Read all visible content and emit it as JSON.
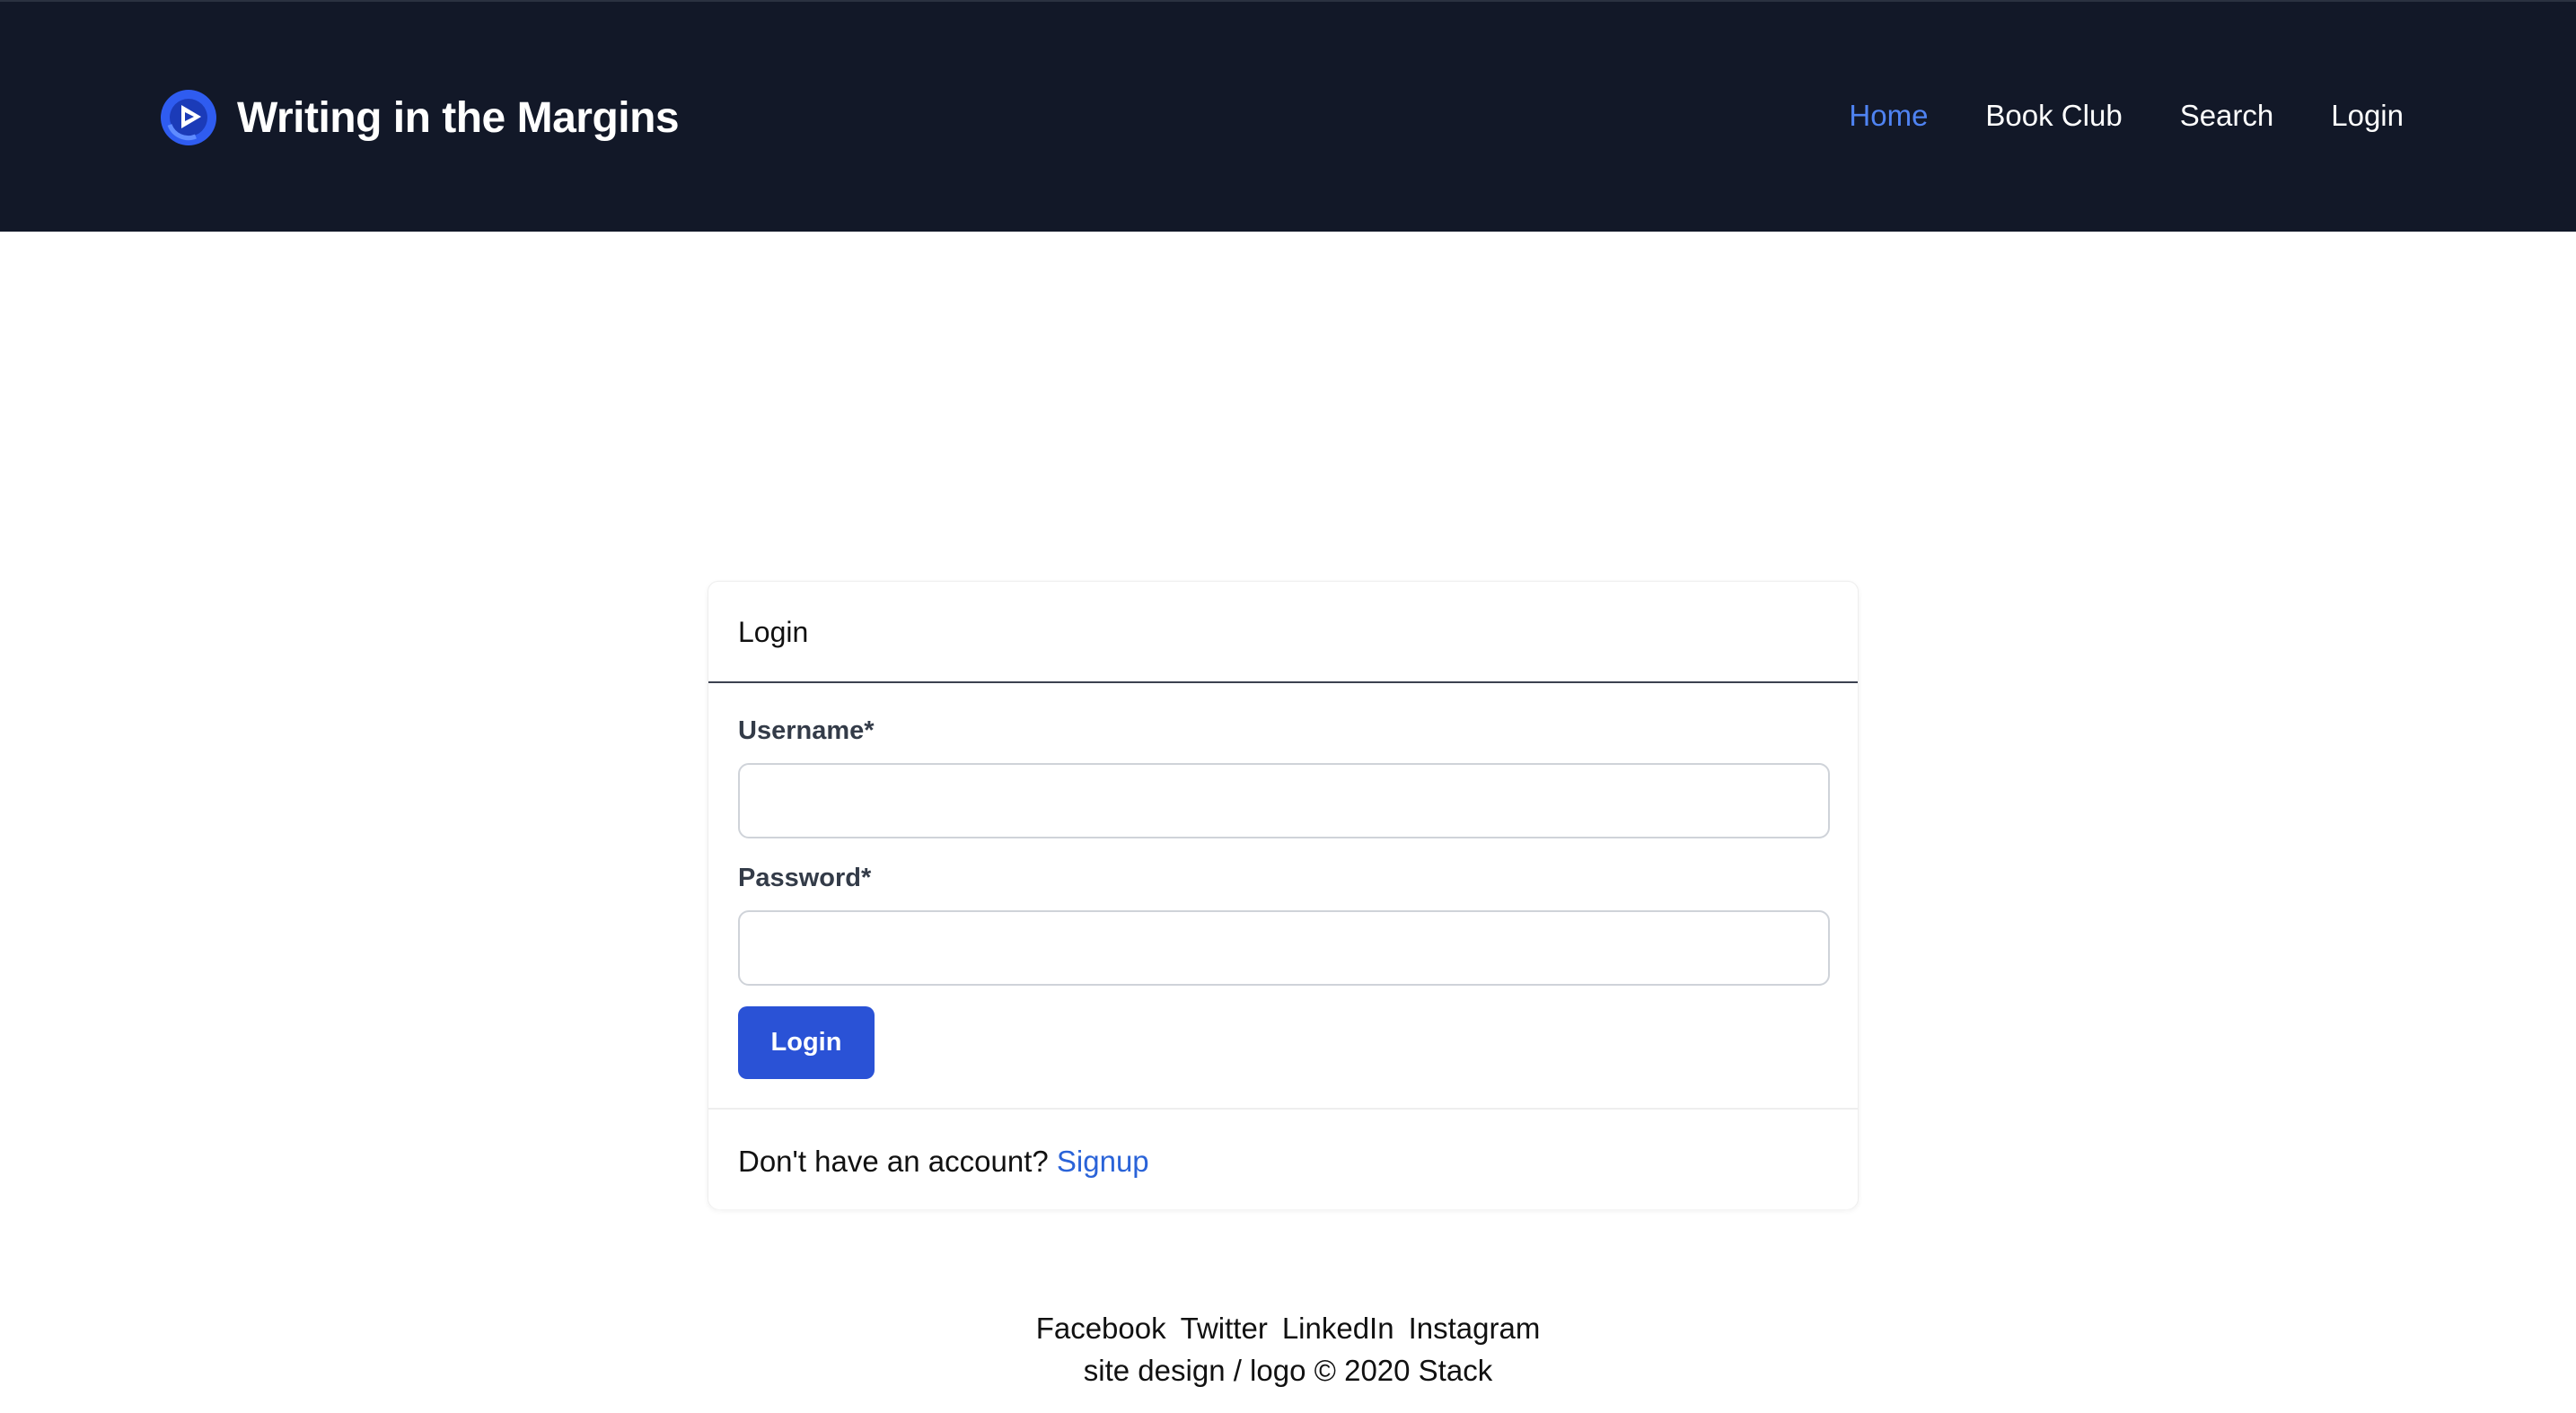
{
  "brand": {
    "title": "Writing in the Margins",
    "logo_icon": "blue-circle-play-logo-icon",
    "accent_color": "#2f5cf0"
  },
  "nav": {
    "items": [
      {
        "label": "Home",
        "active": true
      },
      {
        "label": "Book Club",
        "active": false
      },
      {
        "label": "Search",
        "active": false
      },
      {
        "label": "Login",
        "active": false
      }
    ],
    "background_color": "#121828",
    "active_color": "#4f83f2"
  },
  "login_card": {
    "title": "Login",
    "username_label": "Username*",
    "username_value": "",
    "password_label": "Password*",
    "password_value": "",
    "submit_label": "Login",
    "button_color": "#2a52d6",
    "signup_prompt": "Don't have an account?",
    "signup_link": "Signup"
  },
  "footer": {
    "social": [
      "Facebook",
      "Twitter",
      "LinkedIn",
      "Instagram"
    ],
    "copyright": "site design / logo © 2020 Stack"
  }
}
